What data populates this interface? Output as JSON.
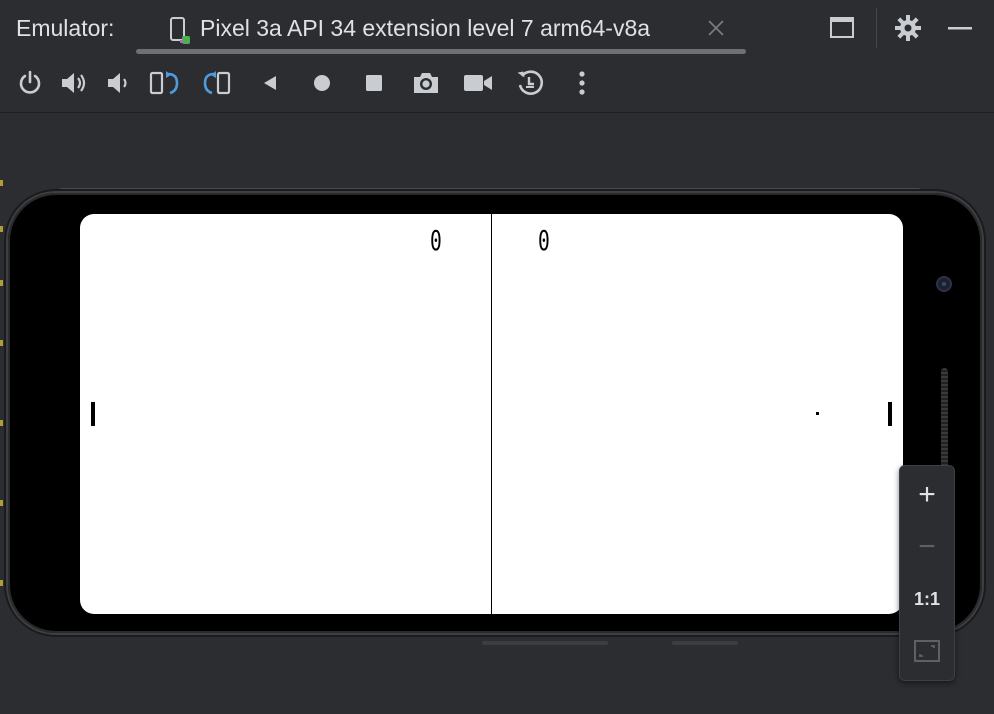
{
  "window": {
    "title": "Emulator:",
    "device_tab": {
      "label": "Pixel 3a API 34 extension level 7 arm64-v8a",
      "icon": "phone-device-icon"
    },
    "controls": [
      "restore-window-icon",
      "settings-gear-icon",
      "minimize-icon"
    ]
  },
  "toolbar": {
    "buttons": [
      {
        "name": "power-button",
        "icon": "power-icon"
      },
      {
        "name": "volume-up-button",
        "icon": "volume-up-icon"
      },
      {
        "name": "volume-down-button",
        "icon": "volume-down-icon"
      },
      {
        "name": "rotate-left-button",
        "icon": "rotate-left-icon"
      },
      {
        "name": "rotate-right-button",
        "icon": "rotate-right-icon"
      },
      {
        "name": "back-button",
        "icon": "back-triangle-icon"
      },
      {
        "name": "home-button",
        "icon": "home-circle-icon"
      },
      {
        "name": "overview-button",
        "icon": "overview-square-icon"
      },
      {
        "name": "screenshot-button",
        "icon": "camera-icon"
      },
      {
        "name": "screen-record-button",
        "icon": "video-camera-icon"
      },
      {
        "name": "snapshot-button",
        "icon": "snapshot-history-icon"
      },
      {
        "name": "more-button",
        "icon": "more-vertical-icon"
      }
    ]
  },
  "game": {
    "score_left": "0",
    "score_right": "0"
  },
  "zoom": {
    "zoom_in": "+",
    "zoom_out": "−",
    "actual_size": "1:1"
  },
  "colors": {
    "chrome_bg": "#2b2d30",
    "icon": "#c9ccd1",
    "accent_blue": "#4f9be0",
    "screen_bg": "#ffffff"
  }
}
